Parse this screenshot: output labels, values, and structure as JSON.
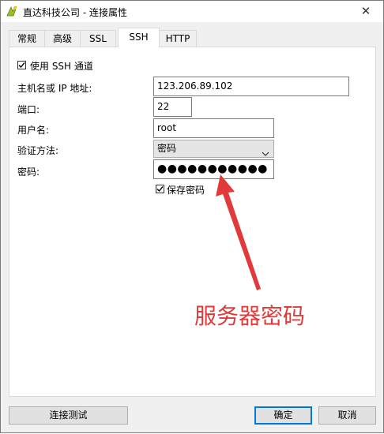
{
  "window": {
    "title": "直达科技公司 - 连接属性",
    "close_symbol": "✕"
  },
  "tabs": [
    {
      "label": "常规",
      "active": false
    },
    {
      "label": "高级",
      "active": false
    },
    {
      "label": "SSL",
      "active": false
    },
    {
      "label": "SSH",
      "active": true
    },
    {
      "label": "HTTP",
      "active": false
    }
  ],
  "ssh": {
    "use_ssh_label": "使用 SSH 通道",
    "use_ssh_checked": true,
    "host_label": "主机名或 IP 地址:",
    "host_value": "123.206.89.102",
    "port_label": "端口:",
    "port_value": "22",
    "user_label": "用户名:",
    "user_value": "root",
    "auth_label": "验证方法:",
    "auth_value": "密码",
    "password_label": "密码:",
    "password_masked": "●●●●●●●●●●●",
    "save_password_label": "保存密码",
    "save_password_checked": true
  },
  "annotation": {
    "text": "服务器密码",
    "color": "#e23a3a"
  },
  "buttons": {
    "test_connection": "连接测试",
    "ok": "确定",
    "cancel": "取消"
  },
  "colors": {
    "accent": "#0078d7",
    "arrow": "#e23a3a"
  }
}
